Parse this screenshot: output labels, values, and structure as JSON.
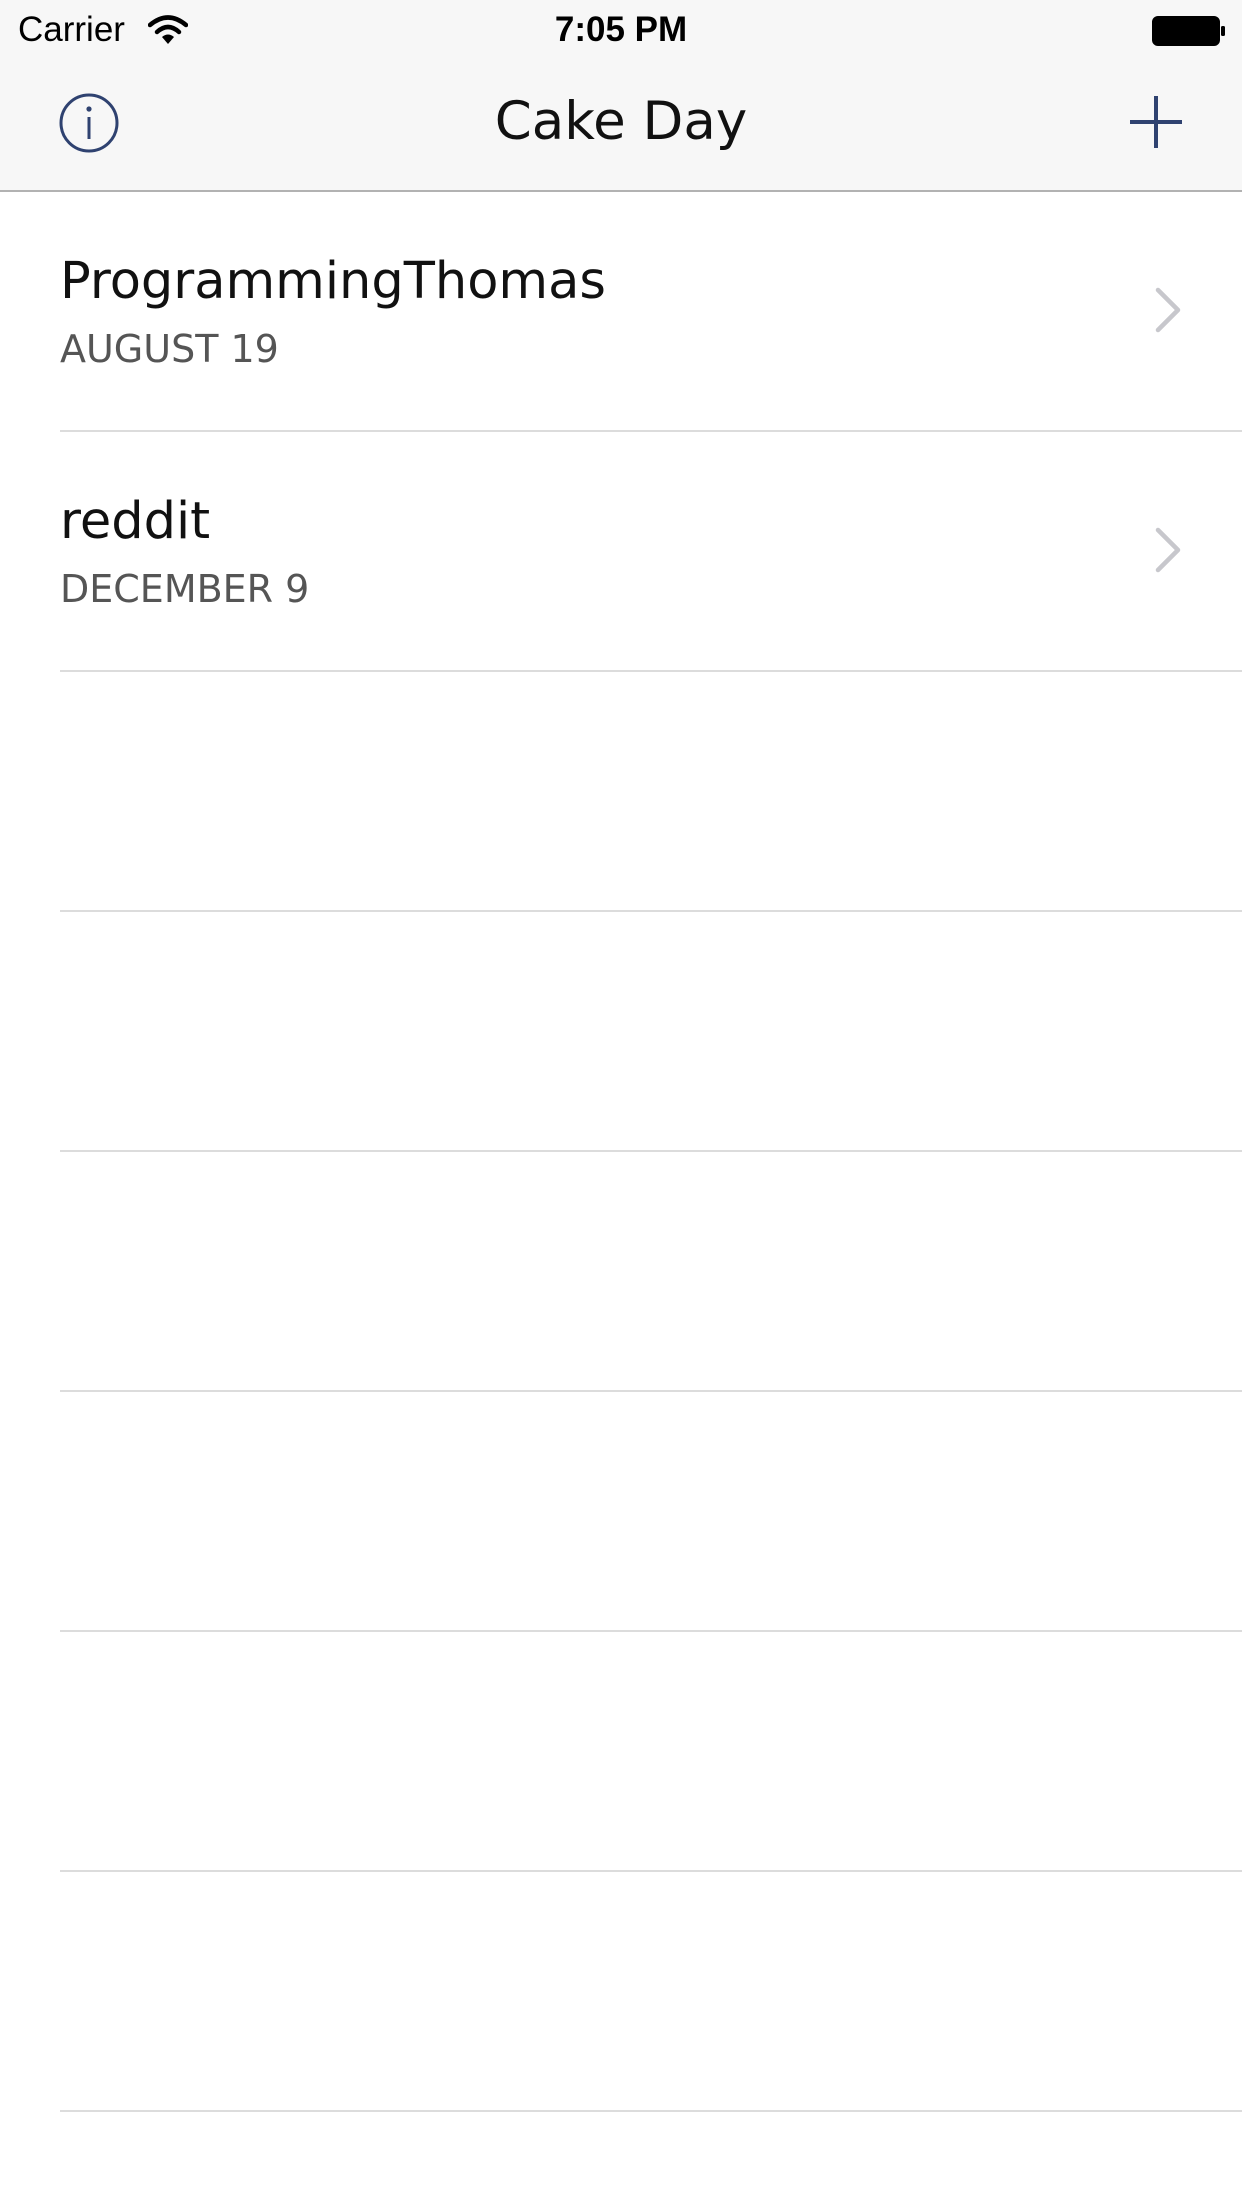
{
  "status_bar": {
    "carrier": "Carrier",
    "time": "7:05 PM"
  },
  "nav": {
    "title": "Cake Day",
    "left_icon": "info-icon",
    "right_icon": "plus-icon",
    "accent_color": "#2f4270"
  },
  "list": {
    "items": [
      {
        "title": "ProgrammingThomas",
        "date": "AUGUST 19"
      },
      {
        "title": "reddit",
        "date": "DECEMBER 9"
      }
    ]
  }
}
